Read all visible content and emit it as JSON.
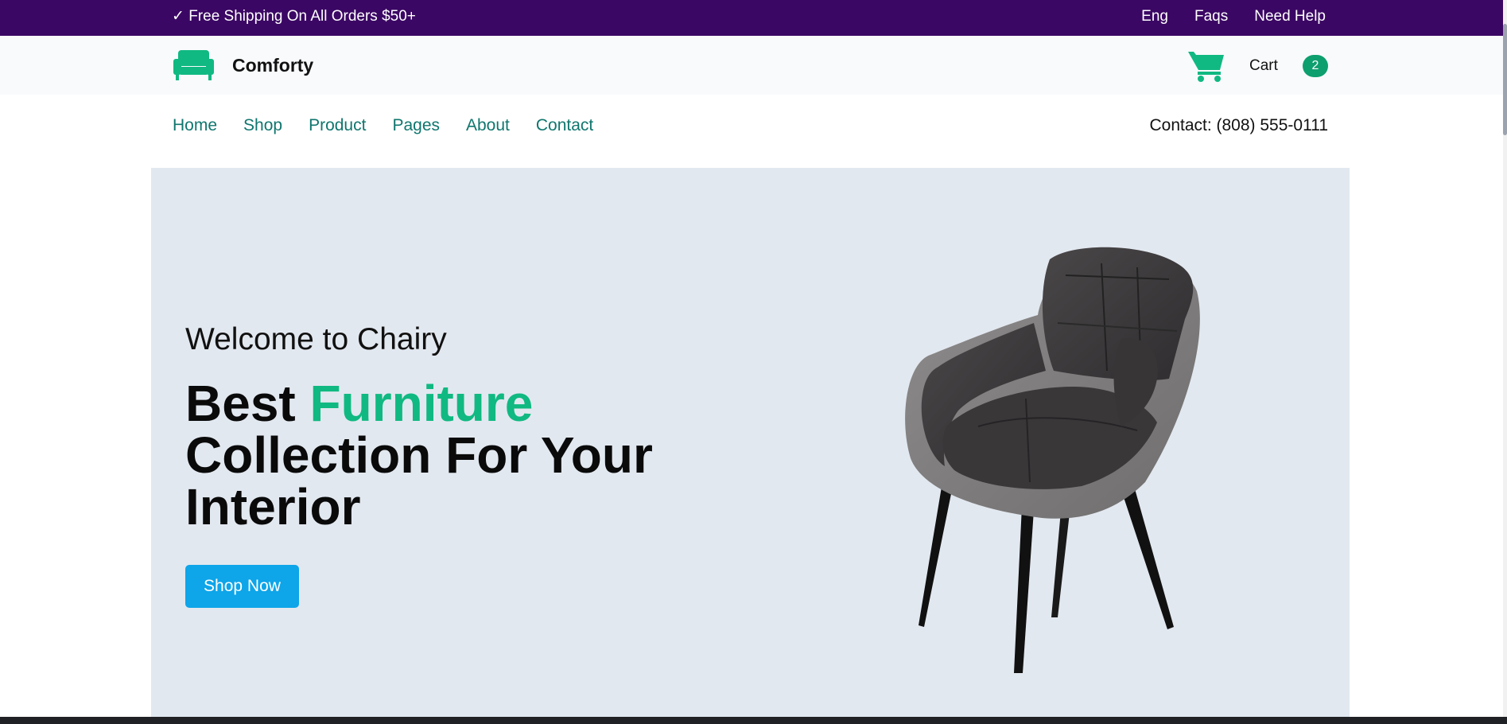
{
  "topbar": {
    "shipping_text": "✓ Free Shipping On All Orders $50+",
    "links": [
      "Eng",
      "Faqs",
      "Need Help"
    ]
  },
  "header": {
    "brand": "Comforty",
    "logo_icon": "sofa-icon",
    "cart_icon": "cart-icon",
    "cart_label": "Cart",
    "cart_count": "2"
  },
  "nav": {
    "items": [
      "Home",
      "Shop",
      "Product",
      "Pages",
      "About",
      "Contact"
    ],
    "contact": "Contact: (808) 555-0111"
  },
  "hero": {
    "welcome": "Welcome to Chairy",
    "headline_part1": "Best ",
    "headline_accent": "Furniture",
    "headline_part2": "Collection For Your Interior",
    "button_label": "Shop Now",
    "image": "armchair-image"
  },
  "colors": {
    "topbar": "#3b0764",
    "accent_green": "#10b981",
    "nav_link": "#0f766e",
    "button_blue": "#0ea5e9",
    "hero_bg": "#e2e8f0",
    "badge": "#0e9f6e"
  }
}
